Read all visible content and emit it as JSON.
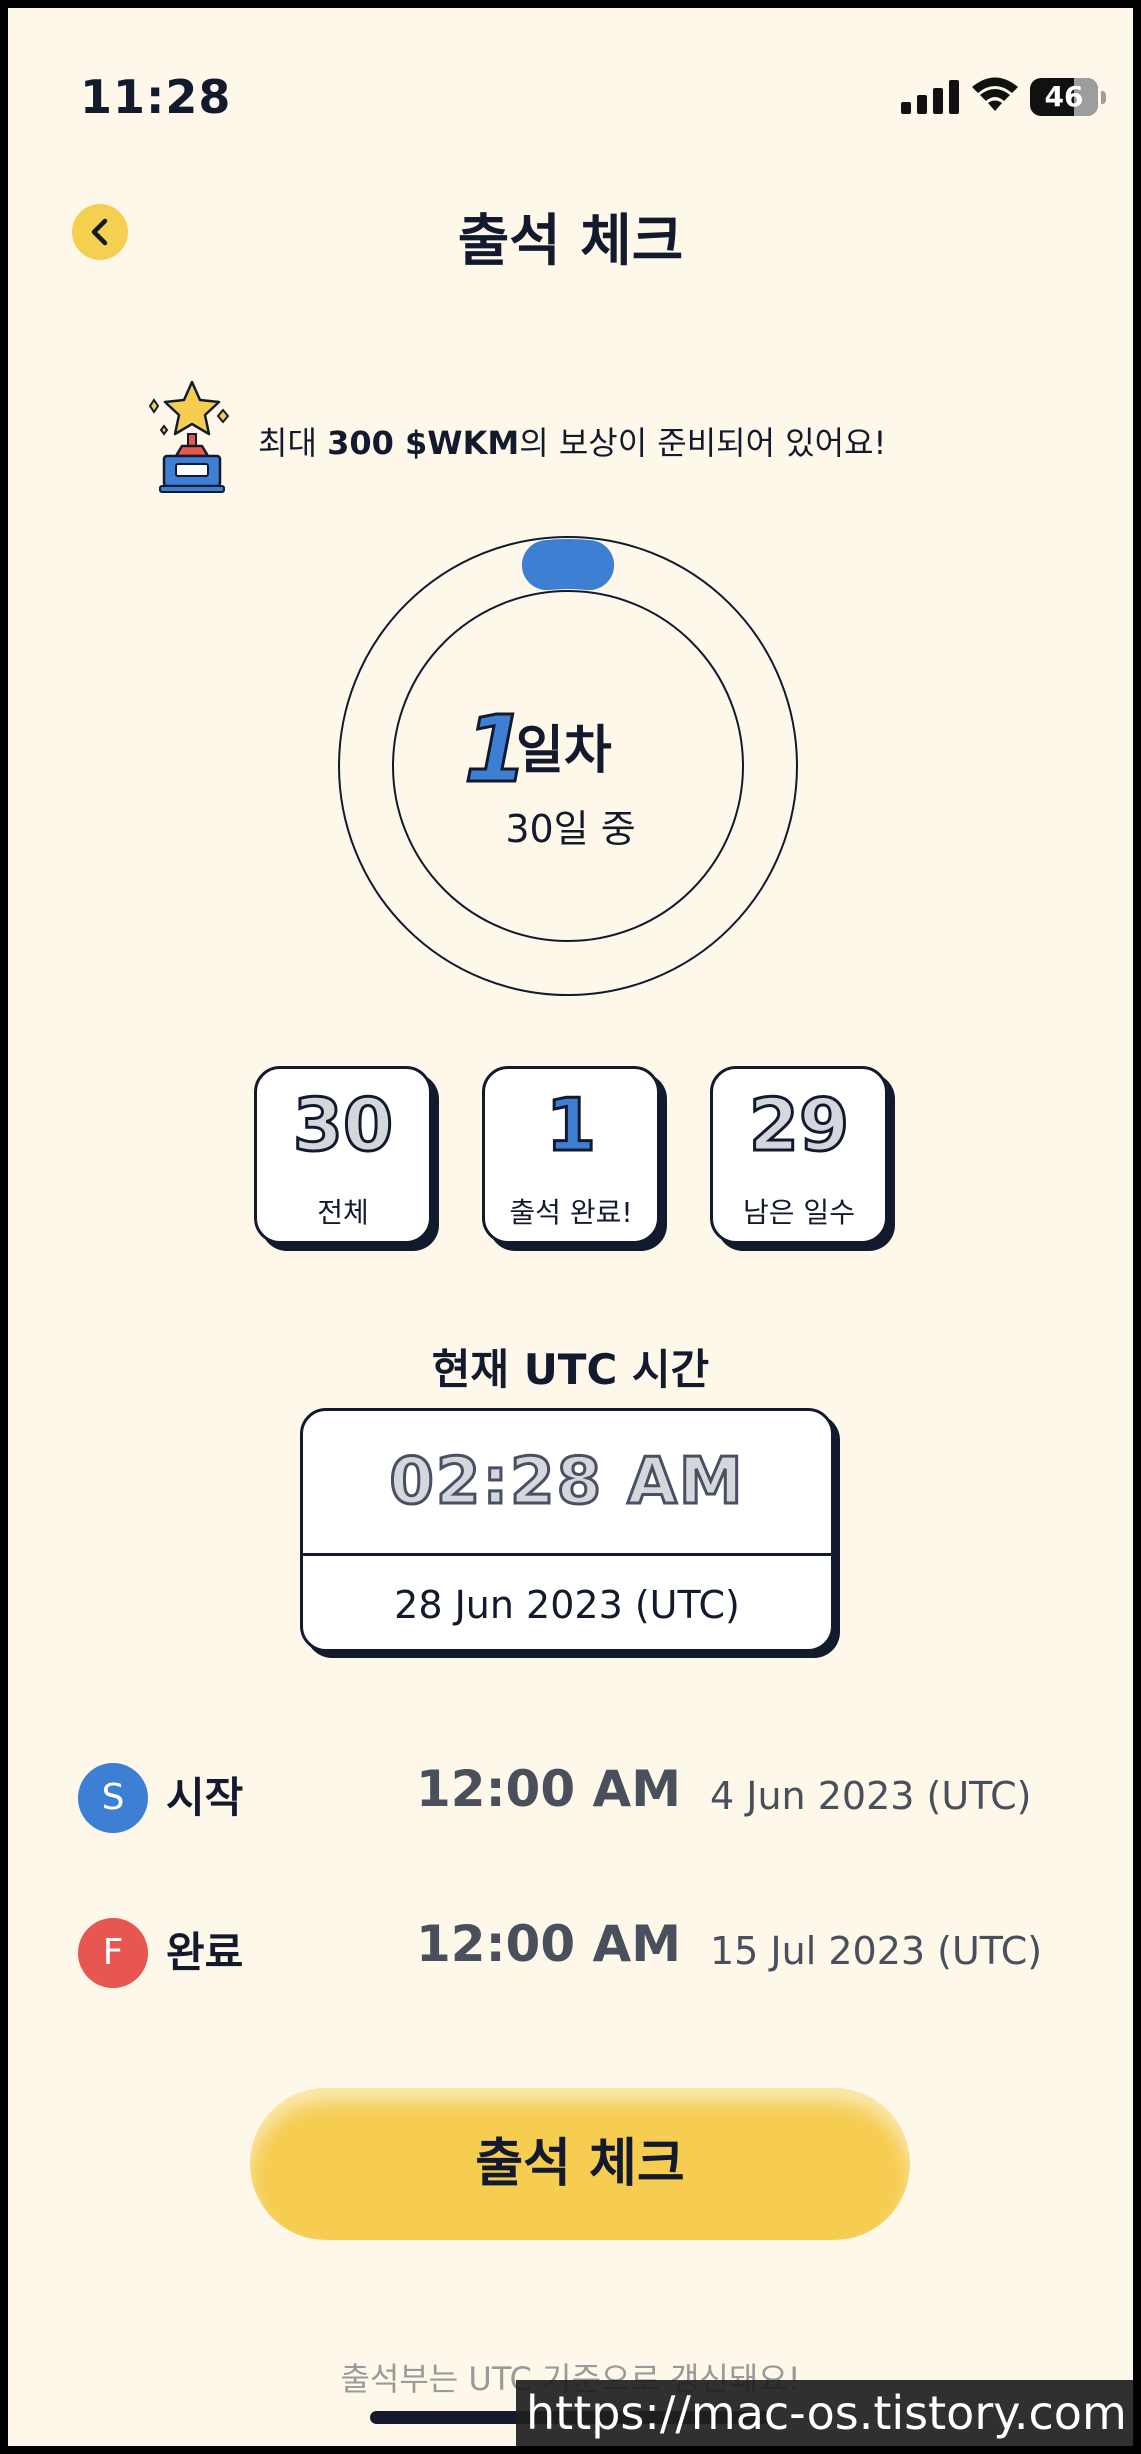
{
  "status_bar": {
    "time": "11:28",
    "battery": "46"
  },
  "header": {
    "title": "출석 체크",
    "back_icon": "chevron-left-icon"
  },
  "reward": {
    "icon": "trophy-star-icon",
    "prefix": "최대 ",
    "amount": "300 $WKM",
    "suffix": "의 보상이 준비되어 있어요!"
  },
  "progress": {
    "day": "1",
    "day_unit": "일차",
    "total_label": "30일 중",
    "completed_fraction": 0.0333
  },
  "stats": [
    {
      "value": "30",
      "label": "전체"
    },
    {
      "value": "1",
      "label": "출석 완료!"
    },
    {
      "value": "29",
      "label": "남은 일수"
    }
  ],
  "current_time": {
    "title_prefix": "현재 ",
    "title_bold": "UTC",
    "title_suffix": " 시간",
    "time": "02:28 AM",
    "date": "28 Jun 2023 (UTC)"
  },
  "schedule": {
    "start": {
      "badge": "S",
      "label": "시작",
      "time": "12:00 AM",
      "date": "4 Jun 2023 (UTC)"
    },
    "finish": {
      "badge": "F",
      "label": "완료",
      "time": "12:00 AM",
      "date": "15 Jul 2023 (UTC)"
    }
  },
  "action": {
    "label": "출석 체크"
  },
  "footer": {
    "note": "출석부는 UTC 기준으로 갱신돼요!"
  },
  "watermark": "https://mac-os.tistory.com",
  "colors": {
    "accent_yellow": "#f6cd51",
    "accent_blue": "#3d7fd3",
    "finish_red": "#e8574f",
    "background": "#fdf8ea",
    "ink": "#141a2e"
  }
}
